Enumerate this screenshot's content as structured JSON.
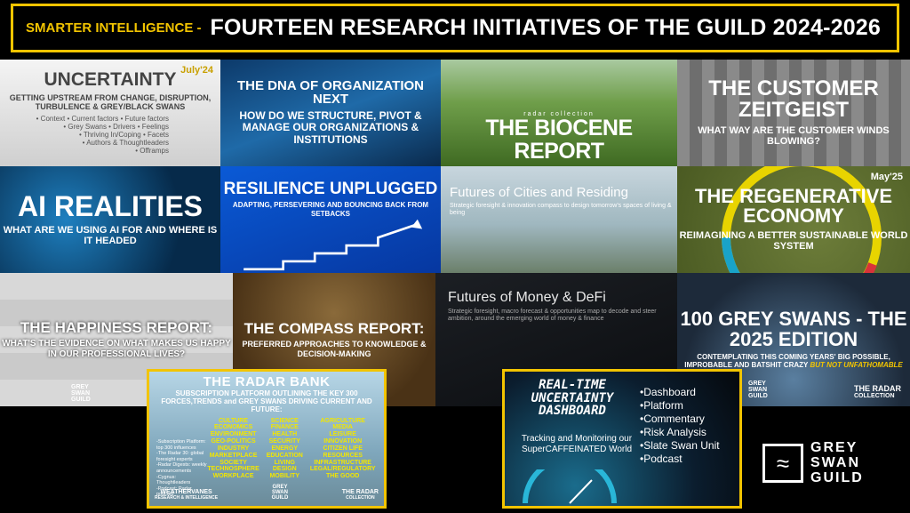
{
  "header": {
    "lead": "SMARTER INTELLIGENCE -",
    "title": "FOURTEEN RESEARCH INITIATIVES OF THE GUILD 2024-2026"
  },
  "tiles": {
    "uncertainty": {
      "date": "July'24",
      "title": "UNCERTAINTY",
      "sub": "GETTING UPSTREAM FROM CHANGE, DISRUPTION, TURBULENCE & GREY/BLACK SWANS",
      "bullets": [
        "• Context • Current factors • Future factors",
        "• Grey Swans • Drivers • Feelings",
        "• Thriving In/Coping • Facets",
        "• Authors & Thoughtleaders",
        "• Offramps"
      ]
    },
    "dna": {
      "title": "THE DNA OF ORGANIZATION NEXT",
      "sub": "HOW DO WE STRUCTURE, PIVOT & MANAGE OUR ORGANIZATIONS & INSTITUTIONS"
    },
    "biocene": {
      "small": "radar collection",
      "title": "THE BIOCENE REPORT"
    },
    "customer": {
      "title": "THE CUSTOMER ZEITGEIST",
      "sub": "WHAT WAY ARE THE CUSTOMER WINDS BLOWING?"
    },
    "ai": {
      "title": "AI REALITIES",
      "sub": "WHAT ARE WE USING AI FOR AND WHERE IS IT HEADED"
    },
    "resilience": {
      "title": "RESILIENCE UNPLUGGED",
      "sub": "ADAPTING, PERSEVERING AND BOUNCING BACK FROM SETBACKS"
    },
    "cities": {
      "title": "Futures of Cities and Residing",
      "sub": "Strategic foresight & innovation compass to design tomorrow's spaces of living & being"
    },
    "regen": {
      "date": "May'25",
      "title": "THE REGENERATIVE ECONOMY",
      "sub": "REIMAGINING A BETTER SUSTAINABLE WORLD SYSTEM"
    },
    "happiness": {
      "title": "THE HAPPINESS REPORT:",
      "sub": "WHAT'S THE EVIDENCE ON WHAT MAKES US HAPPY IN OUR PROFESSIONAL LIVES?"
    },
    "compass": {
      "title": "THE COMPASS REPORT:",
      "sub": "PREFERRED APPROACHES TO KNOWLEDGE & DECISION-MAKING"
    },
    "money": {
      "title": "Futures of Money & DeFi",
      "sub": "Strategic foresight, macro forecast & opportunities map to decode and steer ambition, around the emerging world of money & finance"
    },
    "greyswans": {
      "title": "100 GREY SWANS - THE 2025 EDITION",
      "sub": "CONTEMPLATING THIS COMING YEARS' BIG POSSIBLE, IMPROBABLE AND BATSHIT CRAZY",
      "sub_em": "BUT NOT UNFATHOMABLE"
    }
  },
  "logos": {
    "grey_swan_guild": [
      "GREY",
      "SWAN",
      "GUILD"
    ],
    "weathervanes": "WEATHERVANES",
    "weathervanes_sub": "RESEARCH & INTELLIGENCE",
    "radar": "THE RADAR",
    "radar_sub": "COLLECTION"
  },
  "radar_bank": {
    "title": "THE RADAR BANK",
    "sub": "SUBSCRIPTION PLATFORM OUTLINING THE KEY 300 FORCES,TRENDS and GREY SWANS DRIVING CURRENT AND FUTURE:",
    "list": [
      "-Subscription Platform: top 300 influences",
      "-The Radar 30: global foresight experts",
      "-Radar Digests: weekly announcements",
      "-Cygnus: Thoughtleaders",
      "-Podcast: Radar podcast"
    ],
    "col1": [
      "CULTURE",
      "ECONOMICS",
      "ENVIRONMENT",
      "GEO-POLITICS",
      "INDUSTRY",
      "MARKETPLACE",
      "SOCIETY",
      "TECHNOSPHERE",
      "WORKPLACE"
    ],
    "col2": [
      "SCIENCE",
      "FINANCE",
      "HEALTH",
      "SECURITY",
      "ENERGY",
      "EDUCATION",
      "LIVING",
      "DESIGN",
      "MOBILITY"
    ],
    "col3": [
      "AGRICULTURE",
      "MEDIA",
      "LEISURE",
      "INNOVATION",
      "CITIZEN LIFE",
      "RESOURCES",
      "INFRASTRUCTURE",
      "LEGAL/REGULATORY",
      "THE GOOD"
    ]
  },
  "dashboard": {
    "title": "REAL-TIME UNCERTAINTY DASHBOARD",
    "sub": "Tracking and Monitoring our SuperCAFFEINATED World",
    "items": [
      "Dashboard",
      "Platform",
      "Commentary",
      "Risk Analysis",
      "Slate Swan Unit",
      "Podcast"
    ]
  },
  "colors": {
    "accent": "#f2c400",
    "background": "#000000"
  }
}
